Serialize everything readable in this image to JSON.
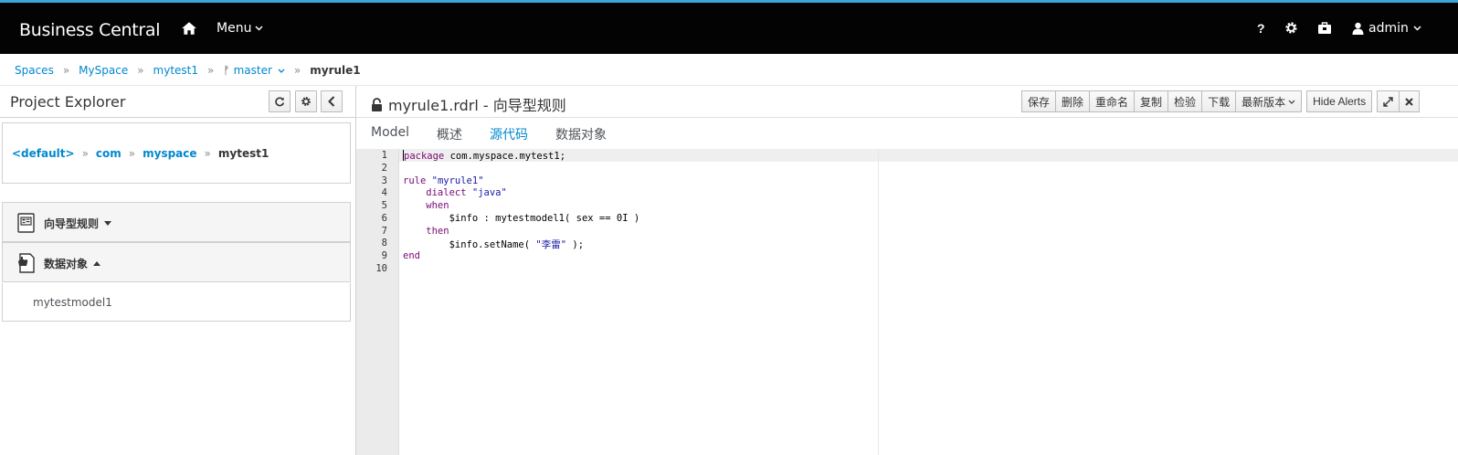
{
  "navbar": {
    "brand": "Business Central",
    "menu_label": "Menu",
    "help_label": "?",
    "user_label": "admin"
  },
  "breadcrumb": {
    "items": [
      "Spaces",
      "MySpace",
      "mytest1",
      "master",
      "myrule1"
    ]
  },
  "project_explorer": {
    "title": "Project Explorer",
    "path": [
      "<default>",
      "com",
      "myspace",
      "mytest1"
    ],
    "sections": [
      {
        "label": "向导型规则",
        "expanded": false
      },
      {
        "label": "数据对象",
        "expanded": true,
        "items": [
          "mytestmodel1"
        ]
      }
    ]
  },
  "editor": {
    "title": "myrule1.rdrl - 向导型规则",
    "toolbar": [
      "保存",
      "删除",
      "重命名",
      "复制",
      "检验",
      "下载",
      "最新版本"
    ],
    "hide_alerts": "Hide Alerts",
    "tabs": [
      "Model",
      "概述",
      "源代码",
      "数据对象"
    ],
    "active_tab": "源代码",
    "line_numbers": [
      "1",
      "2",
      "3",
      "4",
      "5",
      "6",
      "7",
      "8",
      "9",
      "10"
    ],
    "code": {
      "l1_kw": "package",
      "l1_rest": " com.myspace.mytest1;",
      "l3_kw": "rule",
      "l3_str": " \"myrule1\"",
      "l4_kw": "    dialect",
      "l4_str": " \"java\"",
      "l5_kw": "    when",
      "l6": "        $info : mytestmodel1( sex == 0I )",
      "l7_kw": "    then",
      "l8_a": "        $info.setName( ",
      "l8_str": "\"李雷\"",
      "l8_b": " );",
      "l9_kw": "end"
    }
  },
  "colors": {
    "accent": "#0088ce",
    "navbar_bg": "#030303",
    "navbar_top": "#39a5dc"
  }
}
